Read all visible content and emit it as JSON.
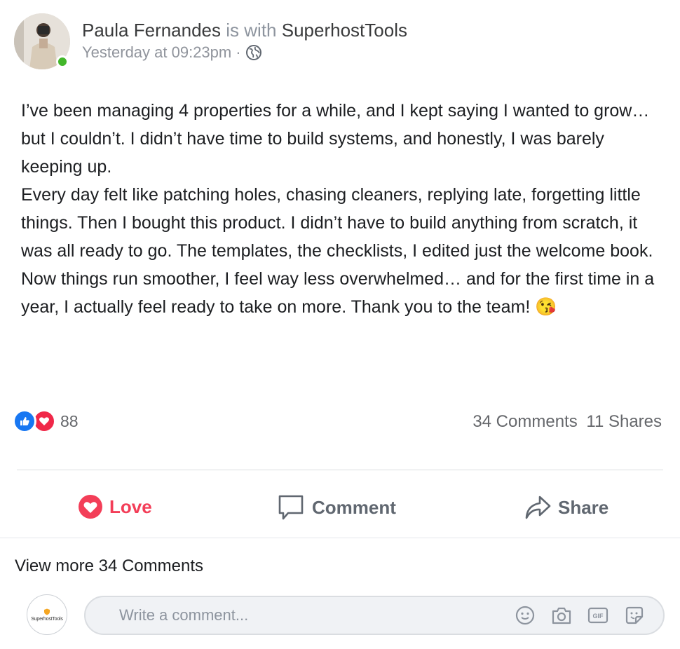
{
  "post": {
    "author": "Paula Fernandes",
    "with_text": "is with",
    "tagged": "SuperhostTools",
    "timestamp": "Yesterday at 09:23pm",
    "separator": "·",
    "privacy_icon": "globe-icon",
    "online_status_color": "#42b72a",
    "paragraphs": [
      "I’ve been managing 4 properties for a while, and I kept saying I wanted to grow… but I couldn’t. I didn’t have time to build systems, and honestly, I was barely keeping up.",
      "Every day felt like patching holes, chasing cleaners, replying late, forgetting little things. Then I bought this product. I didn’t have to build anything from scratch, it was all ready to go. The templates, the checklists, I edited just the welcome book.",
      "Now things run smoother, I feel way less overwhelmed… and for the first time in a year, I actually feel ready to take on more. Thank you to the team!"
    ],
    "ending_emoji": "😘"
  },
  "reactions": {
    "icons": [
      "like-icon",
      "love-icon"
    ],
    "count": "88",
    "comments": "34 Comments",
    "shares": "11 Shares"
  },
  "actions": {
    "love": "Love",
    "comment": "Comment",
    "share": "Share",
    "love_color": "#f33e58"
  },
  "comments": {
    "view_more": "View more 34 Comments",
    "avatar_label": "SuperhostTools",
    "placeholder": "Write a comment...",
    "composer_icons": [
      "emoji-icon",
      "camera-icon",
      "gif-icon",
      "sticker-icon"
    ]
  }
}
